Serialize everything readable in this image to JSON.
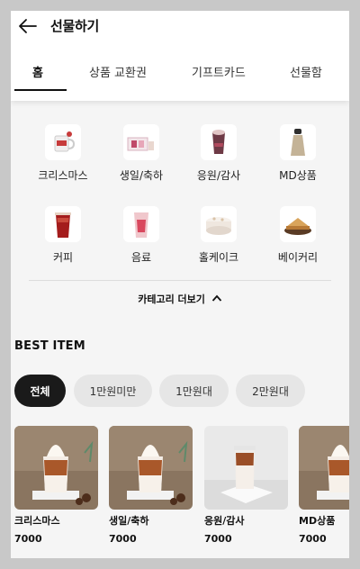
{
  "header": {
    "title": "선물하기"
  },
  "tabs": [
    {
      "label": "홈",
      "active": true
    },
    {
      "label": "상품 교환권",
      "active": false
    },
    {
      "label": "기프트카드",
      "active": false
    },
    {
      "label": "선물함",
      "active": false
    }
  ],
  "categories": [
    {
      "label": "크리스마스",
      "icon": "christmas-mug-icon"
    },
    {
      "label": "생일/축하",
      "icon": "birthday-gift-icon"
    },
    {
      "label": "응원/감사",
      "icon": "cheer-drink-icon"
    },
    {
      "label": "MD상품",
      "icon": "tumbler-icon"
    },
    {
      "label": "커피",
      "icon": "coffee-cup-icon"
    },
    {
      "label": "음료",
      "icon": "beverage-cup-icon"
    },
    {
      "label": "홀케이크",
      "icon": "whole-cake-icon"
    },
    {
      "label": "베이커리",
      "icon": "bakery-icon"
    }
  ],
  "more_categories_label": "카테고리 더보기",
  "best_item_title": "BEST ITEM",
  "filters": [
    {
      "label": "전체",
      "active": true
    },
    {
      "label": "1만원미만",
      "active": false
    },
    {
      "label": "1만원대",
      "active": false
    },
    {
      "label": "2만원대",
      "active": false
    }
  ],
  "products": [
    {
      "name": "크리스마스",
      "price": "7000"
    },
    {
      "name": "생일/축하",
      "price": "7000"
    },
    {
      "name": "응원/감사",
      "price": "7000"
    },
    {
      "name": "MD상품",
      "price": "7000"
    }
  ],
  "colors": {
    "accent": "#1a1a1a",
    "chip_bg": "#e6e6e6",
    "page_bg": "#f5f5f5"
  }
}
